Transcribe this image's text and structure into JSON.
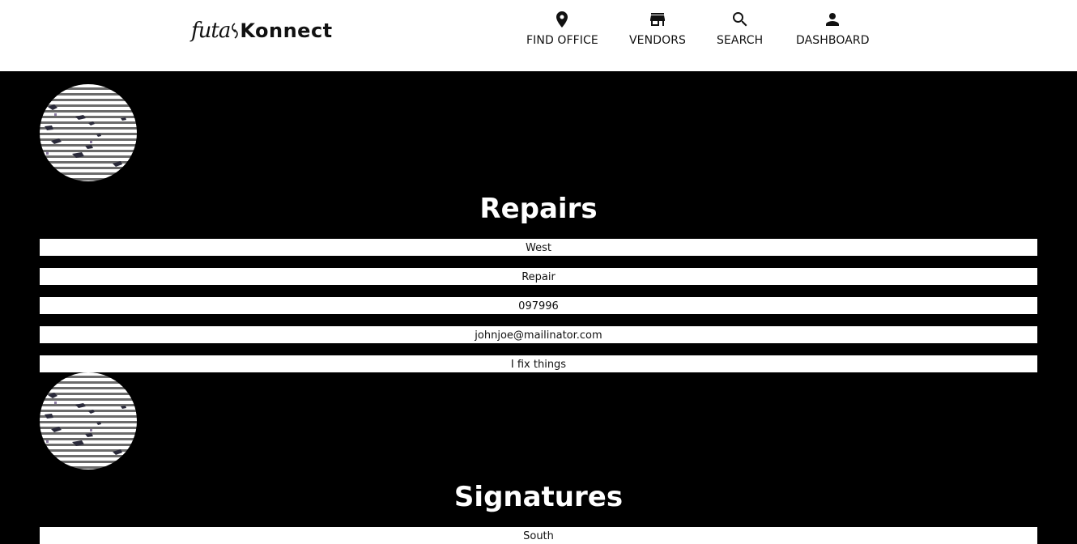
{
  "header": {
    "logo_text_1": "futa",
    "logo_text_2": "Konnect",
    "nav": [
      {
        "label": "FIND OFFICE",
        "icon": "location-pin-icon"
      },
      {
        "label": "VENDORS",
        "icon": "store-icon"
      },
      {
        "label": "SEARCH",
        "icon": "search-icon"
      },
      {
        "label": "DASHBOARD",
        "icon": "person-icon"
      }
    ]
  },
  "vendors": [
    {
      "title": "Repairs",
      "location": "West",
      "category": "Repair",
      "phone": "097996",
      "email": "johnjoe@mailinator.com",
      "description": "I fix things"
    },
    {
      "title": "Signatures",
      "location": "South"
    }
  ],
  "colors": {
    "background": "#000000",
    "header_bg": "#ffffff",
    "field_bg": "#ffffff",
    "title_text": "#ffffff"
  }
}
